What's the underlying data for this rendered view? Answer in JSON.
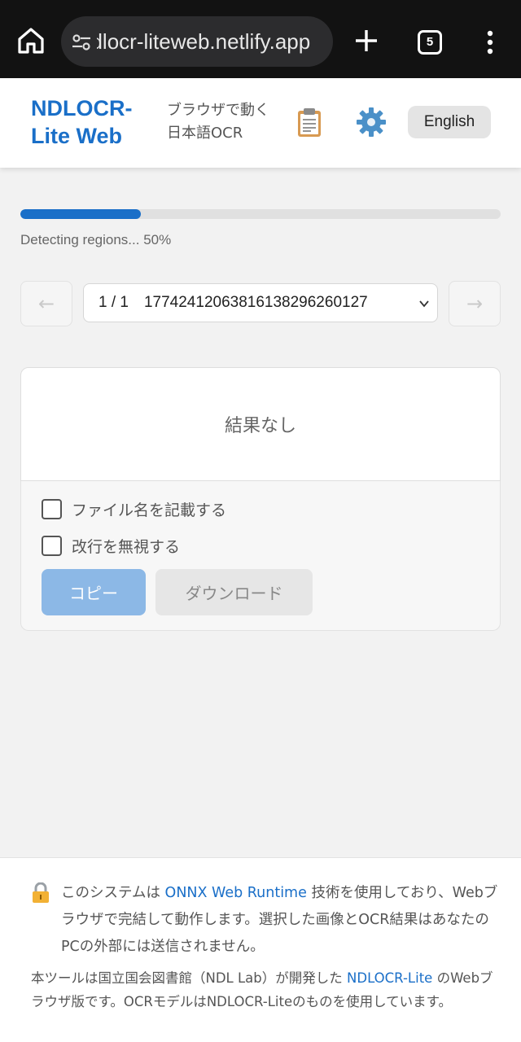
{
  "browser": {
    "url": "ndlocr-liteweb.netlify.app",
    "tab_count": "5"
  },
  "header": {
    "brand_line1": "NDLOCR-",
    "brand_line2": "Lite Web",
    "tagline_line1": "ブラウザで動く",
    "tagline_line2": "日本語OCR",
    "language_button": "English"
  },
  "progress": {
    "fraction": 0.25,
    "status": "Detecting regions... 50%"
  },
  "navigation": {
    "prev_arrow": "←",
    "next_arrow": "→",
    "selected_option": "1 / 1　17742412063816138296260127"
  },
  "result": {
    "empty_text": "結果なし"
  },
  "options": {
    "include_filename_label": "ファイル名を記載する",
    "ignore_newlines_label": "改行を無視する",
    "copy_button": "コピー",
    "download_button": "ダウンロード"
  },
  "footer": {
    "notice_prefix": "このシステムは ",
    "notice_link": "ONNX Web Runtime",
    "notice_suffix": " 技術を使用しており、Webブラウザで完結して動作します。選択した画像とOCR結果はあなたのPCの外部には送信されません。",
    "credit_prefix": "本ツールは国立国会図書館（NDL Lab）が開発した ",
    "credit_link": "NDLOCR-Lite",
    "credit_suffix": " のWebブラウザ版です。OCRモデルはNDLOCR-Liteのものを使用しています。"
  },
  "colors": {
    "brand": "#1a6fc8",
    "copy_disabled": "#8cb8e6"
  },
  "icons": {
    "home": "home-icon",
    "site_settings": "tune-icon",
    "new_tab": "plus-icon",
    "tab_switcher": "tabs-icon",
    "menu": "more-vertical-icon",
    "clipboard": "clipboard-icon",
    "settings": "gear-icon",
    "dropdown": "chevron-down-icon",
    "lock": "lock-icon"
  }
}
